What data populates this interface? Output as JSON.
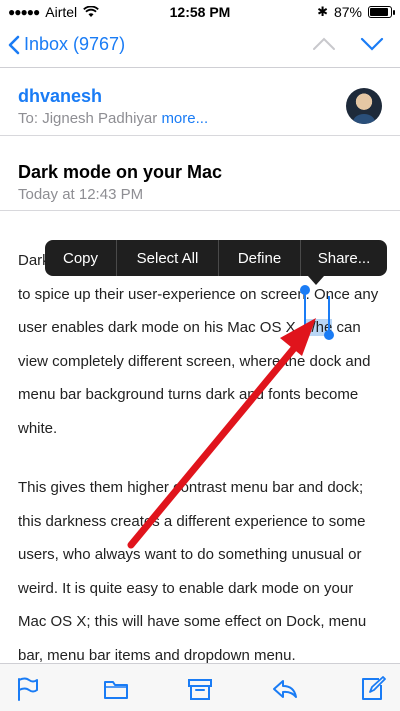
{
  "status_bar": {
    "carrier": "Airtel",
    "time": "12:58 PM",
    "battery": "87%"
  },
  "nav": {
    "back_label": "Inbox (9767)"
  },
  "message": {
    "sender": "dhvanesh",
    "to_prefix": "To:",
    "to_name": "Jignesh Padhiyar",
    "more_label": "more...",
    "subject": "Dark mode on your Mac",
    "date": "Today at 12:43 PM"
  },
  "body": {
    "p1_lead": "Dark",
    "p1_line2": "to spice up their user-experience on screen. Once any",
    "p1_line3_pre": "user enables dark mode on his Mac OS X, ",
    "p1_selected": "s/he",
    "p1_line3_post": " can",
    "p1_line4": "view completely different screen, where the dock and",
    "p1_line5": "menu bar background turns dark and fonts become",
    "p1_line6": "white.",
    "p2": [
      "This gives them higher contrast menu bar and dock;",
      "this darkness creates a different experience to some",
      "users, who always want to do something unusual or",
      "weird. It is quite easy to enable dark mode on your",
      "Mac OS X; this will have some effect on Dock, menu",
      "bar, menu bar items and dropdown menu."
    ]
  },
  "context_menu": {
    "items": [
      "Copy",
      "Select All",
      "Define",
      "Share..."
    ]
  },
  "toolbar": {
    "icons": [
      "flag-icon",
      "folder-icon",
      "archive-icon",
      "reply-icon",
      "compose-icon"
    ]
  },
  "colors": {
    "accent": "#1a7cf5",
    "annotation_arrow": "#e0141c",
    "selection": "#b9d6f5"
  }
}
